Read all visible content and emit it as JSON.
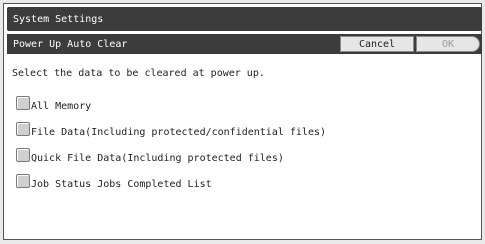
{
  "window": {
    "title": "System Settings"
  },
  "header": {
    "title": "Power Up Auto Clear",
    "cancel_label": "Cancel",
    "ok_label": "OK"
  },
  "main": {
    "instruction": "Select the data to be cleared at power up.",
    "options": [
      {
        "label": "All Memory",
        "checked": false
      },
      {
        "label": "File Data(Including protected/confidential files)",
        "checked": false
      },
      {
        "label": "Quick File Data(Including protected files)",
        "checked": false
      },
      {
        "label": "Job Status Jobs Completed List",
        "checked": false
      }
    ]
  }
}
